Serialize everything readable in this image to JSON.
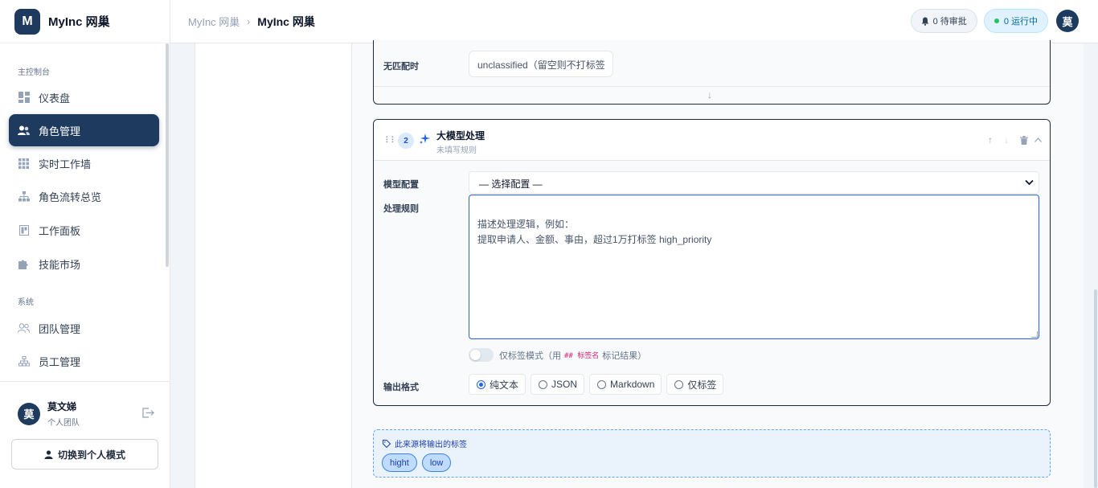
{
  "app": {
    "logo_letter": "M",
    "name": "MyInc 网巢"
  },
  "sidebar": {
    "section_main": "主控制台",
    "section_system": "系统",
    "items": [
      {
        "label": "仪表盘",
        "icon": "dashboard-icon"
      },
      {
        "label": "角色管理",
        "icon": "users-icon",
        "active": true
      },
      {
        "label": "实时工作墙",
        "icon": "grid-icon"
      },
      {
        "label": "角色流转总览",
        "icon": "flow-icon"
      },
      {
        "label": "工作面板",
        "icon": "board-icon"
      },
      {
        "label": "技能市场",
        "icon": "puzzle-icon"
      }
    ],
    "system_items": [
      {
        "label": "团队管理",
        "icon": "team-icon"
      },
      {
        "label": "员工管理",
        "icon": "org-icon"
      }
    ],
    "user": {
      "avatar": "莫",
      "name": "莫文娣",
      "team": "个人团队"
    },
    "switch_label": "切换到个人模式"
  },
  "header": {
    "breadcrumb_root": "MyInc 网巢",
    "breadcrumb_current": "MyInc 网巢",
    "pending": "0 待审批",
    "running": "0 运行中",
    "avatar": "莫"
  },
  "step1": {
    "fallback_label": "无匹配时",
    "fallback_value": "unclassified（留空则不打标签"
  },
  "step2": {
    "number": "2",
    "title": "大模型处理",
    "subtitle": "未填写规则",
    "model_label": "模型配置",
    "model_value": "— 选择配置 —",
    "rule_label": "处理规则",
    "rule_placeholder": "描述处理逻辑，例如：\n提取申请人、金额、事由，超过1万打标签 high_priority",
    "tag_only_prefix": "仅标签模式（用",
    "tag_only_code": "## 标签名",
    "tag_only_suffix": "标记结果）",
    "output_label": "输出格式",
    "output_options": [
      "纯文本",
      "JSON",
      "Markdown",
      "仅标签"
    ],
    "output_selected": "纯文本"
  },
  "tags": {
    "title": "此来源将输出的标签",
    "items": [
      "hight",
      "low"
    ]
  },
  "colors": {
    "brand": "#1e3a5f",
    "accent": "#2563eb",
    "tag_bg": "#bfdbfe"
  }
}
